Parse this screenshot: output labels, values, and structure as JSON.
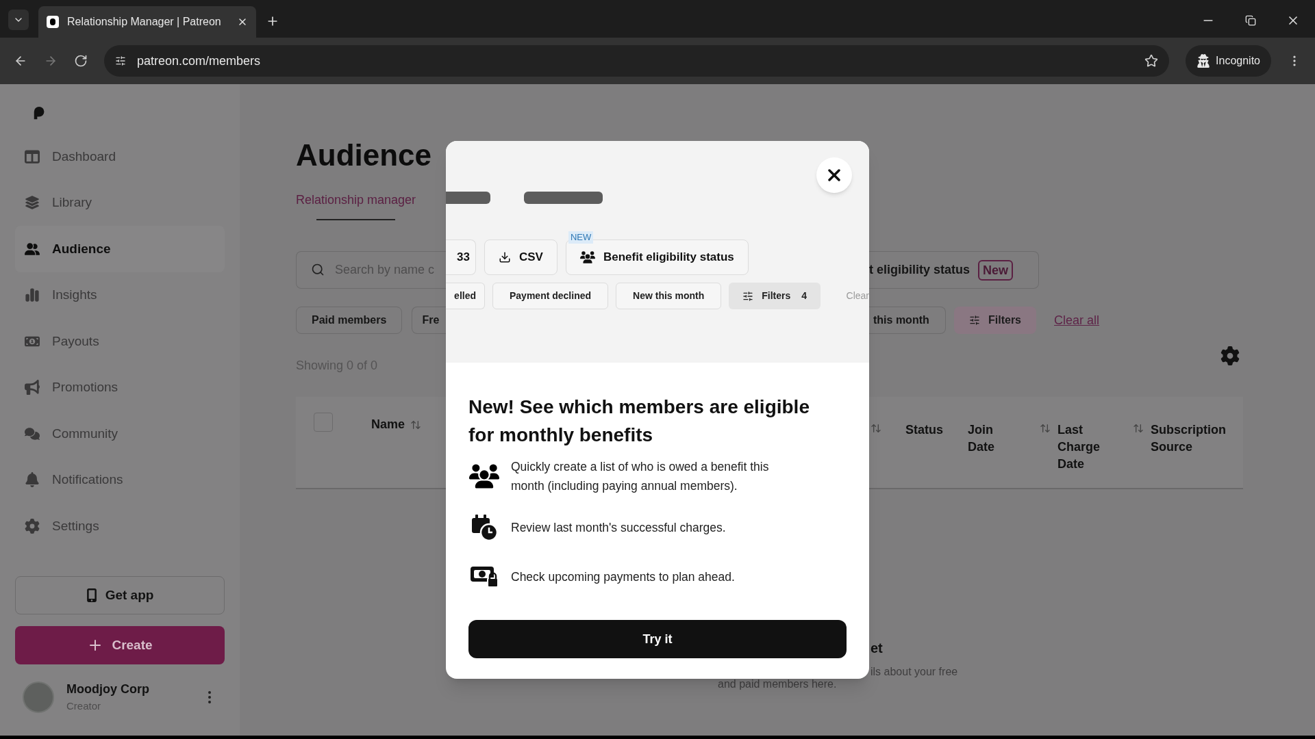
{
  "browser": {
    "tab_title": "Relationship Manager | Patreon",
    "url": "patreon.com/members",
    "profile": "Incognito"
  },
  "sidebar": {
    "items": [
      {
        "label": "Dashboard",
        "kind": "dashboard",
        "selected": false
      },
      {
        "label": "Library",
        "kind": "library",
        "selected": false
      },
      {
        "label": "Audience",
        "kind": "audience",
        "selected": true
      },
      {
        "label": "Insights",
        "kind": "insights",
        "selected": false
      },
      {
        "label": "Payouts",
        "kind": "payouts",
        "selected": false
      },
      {
        "label": "Promotions",
        "kind": "promotions",
        "selected": false
      },
      {
        "label": "Community",
        "kind": "community",
        "selected": false
      },
      {
        "label": "Notifications",
        "kind": "notifications",
        "selected": false
      },
      {
        "label": "Settings",
        "kind": "settings",
        "selected": false
      }
    ],
    "get_app": "Get app",
    "create": "Create",
    "user": {
      "name": "Moodjoy Corp",
      "role": "Creator"
    }
  },
  "page": {
    "title": "Audience",
    "tabs": [
      {
        "label": "Relationship manager",
        "selected": true
      }
    ],
    "search": {
      "placeholder": "Search by name c"
    },
    "benefit_button": {
      "label": "t eligibility status",
      "badge": "New"
    },
    "left_chips": [
      "Paid members",
      "Fre"
    ],
    "right_chips": [
      {
        "label": "this month",
        "kind": "chip"
      },
      {
        "label": "Filters",
        "kind": "filters"
      }
    ],
    "clear": "Clear all",
    "showing": "Showing 0 of 0",
    "select_all": {
      "checked": false
    },
    "left_columns": [
      {
        "label": "Name",
        "sortable": true
      }
    ],
    "right_columns": [
      {
        "sortable": true
      },
      {
        "label": "Status",
        "sortable": false
      },
      {
        "label": "Join Date",
        "sortable": true
      },
      {
        "label": "Last Charge Date",
        "sortable": true
      },
      {
        "label": "Subscription Source",
        "sortable": false
      }
    ],
    "empty_state": {
      "title": "et",
      "line_1": "ils about your free",
      "line_2": "and paid members here."
    }
  },
  "modal": {
    "preview": {
      "buttons": [
        {
          "label": "33",
          "kind": "plain"
        },
        {
          "label": "CSV",
          "kind": "download"
        },
        {
          "label": "Benefit eligibility status",
          "kind": "people",
          "badge": "NEW"
        }
      ],
      "chips": [
        {
          "label": "elled",
          "kind": "chip"
        },
        {
          "label": "Payment declined",
          "kind": "chip"
        },
        {
          "label": "New this month",
          "kind": "chip"
        },
        {
          "label": "Filters",
          "count": "4",
          "kind": "filters"
        }
      ],
      "clear": "Clear"
    },
    "title": "New! See which members are eligible for monthly benefits",
    "features": [
      {
        "kind": "people",
        "text": "Quickly create a list of who is owed a benefit this month (including paying annual members)."
      },
      {
        "kind": "calendar",
        "text": "Review last month's successful charges."
      },
      {
        "kind": "money",
        "text": "Check upcoming payments to plan ahead."
      }
    ],
    "cta": "Try it"
  }
}
